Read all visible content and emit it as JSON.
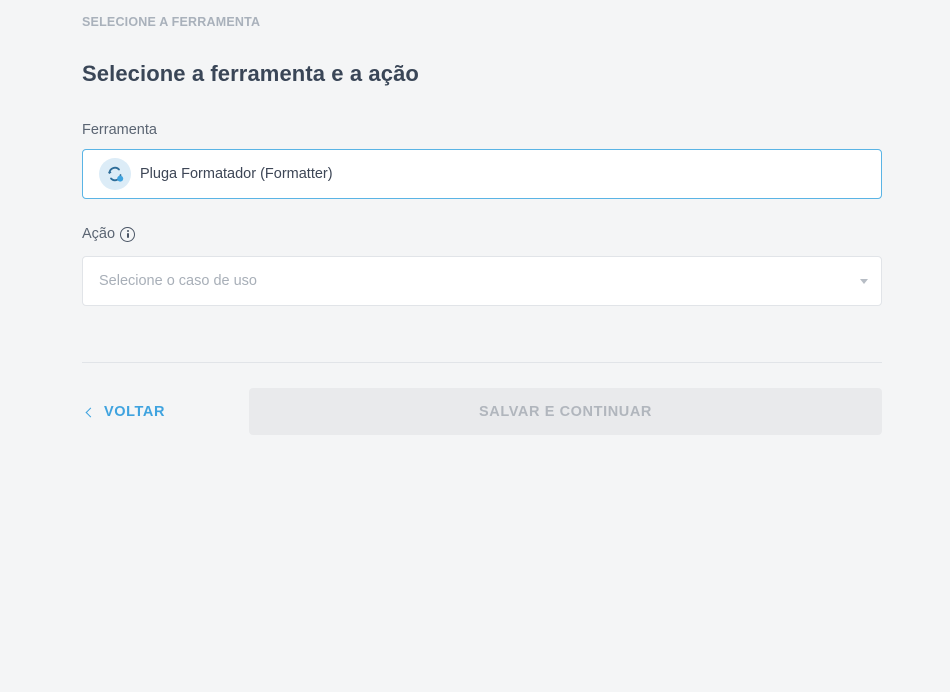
{
  "step": {
    "label": "SELECIONE A FERRAMENTA"
  },
  "page": {
    "title": "Selecione a ferramenta e a ação"
  },
  "tool_field": {
    "label": "Ferramenta",
    "value": "Pluga Formatador (Formatter)",
    "icon": "formatter-cycle-icon"
  },
  "action_field": {
    "label": "Ação",
    "info_icon": "info-icon",
    "placeholder": "Selecione o caso de uso",
    "caret_icon": "caret-down-icon"
  },
  "footer": {
    "back_label": "VOLTAR",
    "save_label": "SALVAR E CONTINUAR",
    "save_enabled": false
  },
  "colors": {
    "accent": "#3fa3df",
    "focus_border": "#5ab4e5",
    "disabled_bg": "#e9eaec",
    "disabled_text": "#b1b6bd",
    "page_bg": "#f4f5f6"
  }
}
